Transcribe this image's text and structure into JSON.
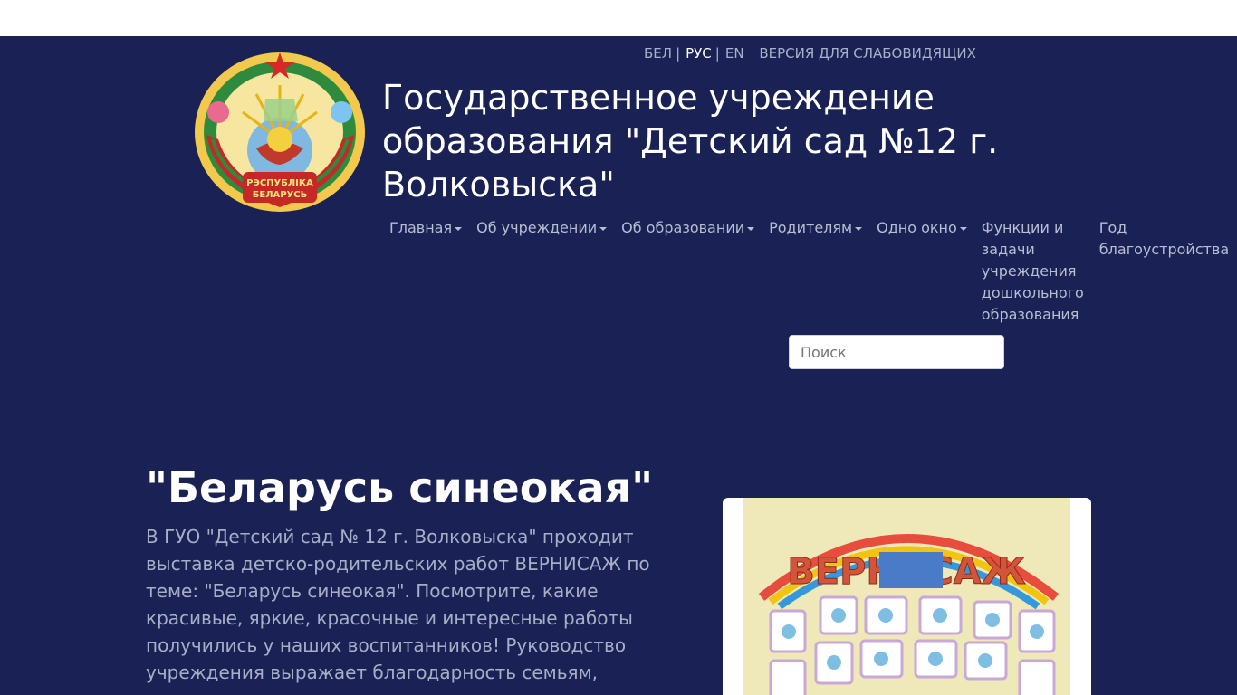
{
  "languages": [
    {
      "label": "БЕЛ",
      "active": false
    },
    {
      "label": "РУС",
      "active": true
    },
    {
      "label": "EN",
      "active": false
    }
  ],
  "accessibility_label": "ВЕРСИЯ ДЛЯ СЛАБОВИДЯЩИХ",
  "emblem": {
    "ribbon_text_1": "РЭСПУБЛІКА",
    "ribbon_text_2": "БЕЛАРУСЬ"
  },
  "site_title": "Государственное учреждение образования \"Детский сад №12 г. Волковыска\"",
  "nav": {
    "items": [
      {
        "label": "Главная",
        "dropdown": true
      },
      {
        "label": "Об учреждении",
        "dropdown": true
      },
      {
        "label": "Об образовании",
        "dropdown": true
      },
      {
        "label": "Родителям",
        "dropdown": true
      },
      {
        "label": "Одно окно",
        "dropdown": true
      },
      {
        "label": "Функции и задачи учреждения дошкольного образования",
        "dropdown": false
      },
      {
        "label": "Год благоустройства",
        "dropdown": false
      }
    ]
  },
  "search": {
    "placeholder": "Поиск"
  },
  "article": {
    "title": "\"Беларусь синеокая\"",
    "text": "В ГУО \"Детский сад № 12 г. Волковыска\" проходит выставка детско-родительских работ ВЕРНИСАЖ по теме: \"Беларусь синеокая\". Посмотрите, какие красивые, яркие, красочные и интересные работы получились у наших воспитанников! Руководство учреждения выражает благодарность семьям,"
  },
  "photo": {
    "banner_text": "ВЕРНИСАЖ"
  },
  "colors": {
    "header_bg": "#192155",
    "nav_text": "#b9bed2",
    "white": "#ffffff"
  }
}
